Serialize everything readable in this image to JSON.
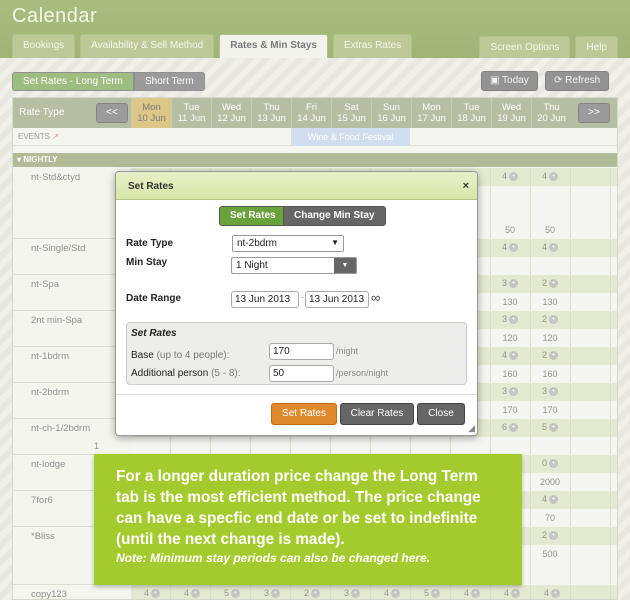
{
  "app": {
    "title": "Calendar"
  },
  "tabs": [
    {
      "label": "Bookings"
    },
    {
      "label": "Availability & Sell Method"
    },
    {
      "label": "Rates & Min Stays",
      "active": true
    },
    {
      "label": "Extras Rates"
    }
  ],
  "header_right": {
    "screen_options": "Screen Options",
    "help": "Help"
  },
  "term_toggle": {
    "long_term": "Set Rates - Long Term",
    "short_term": "Short Term"
  },
  "toolbar": {
    "today": "Today",
    "refresh": "Refresh"
  },
  "calendar": {
    "rate_type_label": "Rate Type",
    "prev": "<<",
    "next": ">>",
    "days": [
      {
        "dow": "Mon",
        "date": "10 Jun",
        "today": true
      },
      {
        "dow": "Tue",
        "date": "11 Jun"
      },
      {
        "dow": "Wed",
        "date": "12 Jun"
      },
      {
        "dow": "Thu",
        "date": "13 Jun"
      },
      {
        "dow": "Fri",
        "date": "14 Jun"
      },
      {
        "dow": "Sat",
        "date": "15 Jun"
      },
      {
        "dow": "Sun",
        "date": "16 Jun"
      },
      {
        "dow": "Mon",
        "date": "17 Jun"
      },
      {
        "dow": "Tue",
        "date": "18 Jun"
      },
      {
        "dow": "Wed",
        "date": "19 Jun"
      },
      {
        "dow": "Thu",
        "date": "20 Jun"
      }
    ],
    "events_label": "EVENTS",
    "event_name": "Wine & Food Festival",
    "group_label": "NIGHTLY",
    "rows": [
      {
        "name": "nt-Std&ctyd",
        "col9": "4",
        "col10": "4",
        "rate9": "50",
        "rate10": "50"
      },
      {
        "name": "nt-Single/Std",
        "col9": "4",
        "col10": "4"
      },
      {
        "name": "nt-Spa",
        "col9": "3",
        "col10": "2",
        "rate9": "130",
        "rate10": "130"
      },
      {
        "name": "2nt min-Spa",
        "col9": "3",
        "col10": "2",
        "rate9": "120",
        "rate10": "120"
      },
      {
        "name": "nt-1bdrm",
        "col9": "4",
        "col10": "2",
        "rate9": "160",
        "rate10": "160"
      },
      {
        "name": "nt-2bdrm",
        "col9": "3",
        "col10": "3",
        "rate9": "170",
        "rate10": "170"
      },
      {
        "name": "nt-ch-1/2bdrm",
        "col9": "6",
        "col10": "5",
        "extra": "1"
      },
      {
        "name": "nt-lodge",
        "col10": "0",
        "rate10": "2000"
      },
      {
        "name": "7for6",
        "col10": "4",
        "rate10": "70"
      },
      {
        "name": "*Bliss",
        "col10": "2",
        "rate10": "500"
      },
      {
        "name": "copy123",
        "cells": [
          "4",
          "4",
          "5",
          "3",
          "2",
          "3",
          "4",
          "5",
          "4",
          "4",
          "4"
        ]
      }
    ]
  },
  "modal": {
    "title": "Set Rates",
    "close": "×",
    "toggle_set_rates": "Set Rates",
    "toggle_min_stay": "Change Min Stay",
    "rate_type_label": "Rate Type",
    "rate_type_value": "nt-2bdrm",
    "min_stay_label": "Min Stay",
    "min_stay_value": "1 Night",
    "date_range_label": "Date Range",
    "date_from": "13 Jun 2013",
    "date_sep": "-",
    "date_to": "13 Jun 2013",
    "infinity": "∞",
    "fieldset_title": "Set Rates",
    "base_label": "Base",
    "base_hint": "(up to 4 people):",
    "base_value": "170",
    "base_unit": "/night",
    "additional_label": "Additional person",
    "additional_hint": "(5 - 8):",
    "additional_value": "50",
    "additional_unit": "/person/night",
    "btn_set": "Set Rates",
    "btn_clear": "Clear Rates",
    "btn_close": "Close"
  },
  "callout": {
    "text": "For a longer duration price change the Long Term tab is the most efficient method. The price change can have a specfic end date or be set to indefinite (until the next change is made).",
    "note": "Note: Minimum stay periods can also be changed here."
  },
  "colors": {
    "header": "#728f32",
    "accent": "#a4cb2d",
    "today": "#c9a94a",
    "event": "#b7cde8",
    "orange": "#e08a2e"
  }
}
